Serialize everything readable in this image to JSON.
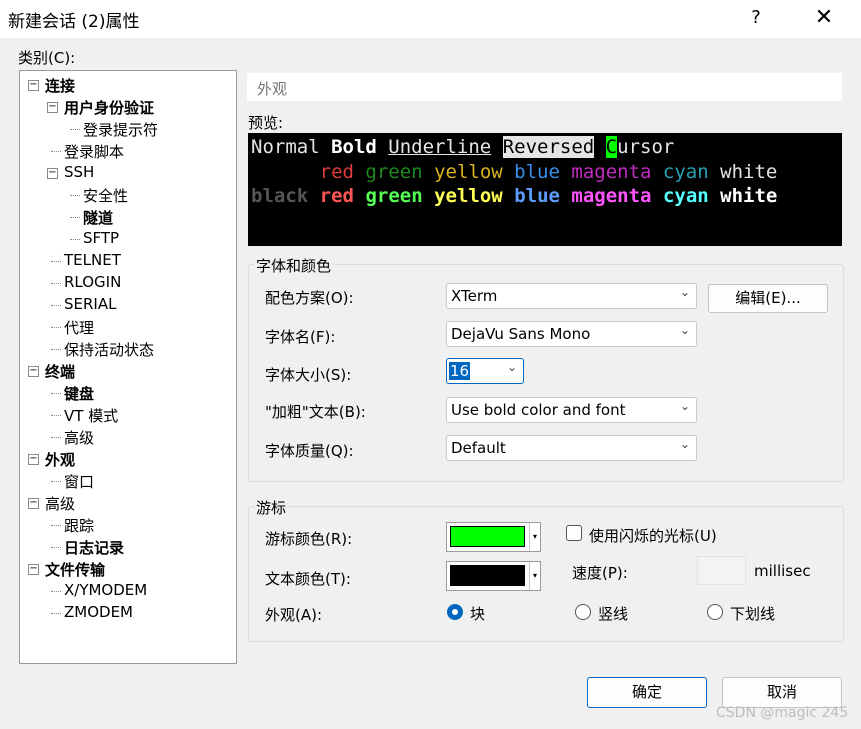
{
  "window": {
    "title": "新建会话 (2)属性",
    "help_label": "?",
    "close_label": "✕"
  },
  "category_label": "类别(C):",
  "tree": [
    {
      "label": "连接",
      "bold": true,
      "toggle": "−"
    },
    {
      "label": "用户身份验证",
      "bold": true,
      "toggle": "−"
    },
    {
      "label": "登录提示符",
      "bold": false
    },
    {
      "label": "登录脚本",
      "bold": false
    },
    {
      "label": "SSH",
      "bold": false,
      "toggle": "−"
    },
    {
      "label": "安全性",
      "bold": false
    },
    {
      "label": "隧道",
      "bold": true
    },
    {
      "label": "SFTP",
      "bold": false
    },
    {
      "label": "TELNET",
      "bold": false
    },
    {
      "label": "RLOGIN",
      "bold": false
    },
    {
      "label": "SERIAL",
      "bold": false
    },
    {
      "label": "代理",
      "bold": false
    },
    {
      "label": "保持活动状态",
      "bold": false
    },
    {
      "label": "终端",
      "bold": true,
      "toggle": "−"
    },
    {
      "label": "键盘",
      "bold": true
    },
    {
      "label": "VT 模式",
      "bold": false
    },
    {
      "label": "高级",
      "bold": false
    },
    {
      "label": "外观",
      "bold": true,
      "toggle": "−"
    },
    {
      "label": "窗口",
      "bold": false
    },
    {
      "label": "高级",
      "bold": false,
      "toggle": "−"
    },
    {
      "label": "跟踪",
      "bold": false
    },
    {
      "label": "日志记录",
      "bold": true
    },
    {
      "label": "文件传输",
      "bold": true,
      "toggle": "−"
    },
    {
      "label": "X/YMODEM",
      "bold": false
    },
    {
      "label": "ZMODEM",
      "bold": false
    }
  ],
  "section_header": "外观",
  "preview": {
    "label": "预览:",
    "line1": {
      "normal": "Normal ",
      "bold": "Bold",
      "underline": "Underline",
      "reversed": "Reversed",
      "cursor_char": "C",
      "cursor_rest": "ursor"
    },
    "colors": [
      {
        "text": "red",
        "color": "#e03a3a",
        "bright": "#ff5555"
      },
      {
        "text": "green",
        "color": "#1f8a1f",
        "bright": "#55ff55"
      },
      {
        "text": "yellow",
        "color": "#d7b21d",
        "bright": "#ffff55"
      },
      {
        "text": "blue",
        "color": "#3b8eea",
        "bright": "#5c9cff"
      },
      {
        "text": "magenta",
        "color": "#c02cc0",
        "bright": "#ff55ff"
      },
      {
        "text": "cyan",
        "color": "#2aa1b3",
        "bright": "#55ffff"
      },
      {
        "text": "white",
        "color": "#e5e5e5",
        "bright": "#ffffff"
      }
    ],
    "black_label": "black",
    "cursor_color": "#00ff00"
  },
  "font_group": {
    "title": "字体和颜色",
    "color_scheme_label": "配色方案(O):",
    "color_scheme_value": "XTerm",
    "edit_button": "编辑(E)...",
    "font_name_label": "字体名(F):",
    "font_name_value": "DejaVu Sans Mono",
    "font_size_label": "字体大小(S):",
    "font_size_value": "16",
    "bold_text_label": "\"加粗\"文本(B):",
    "bold_text_value": "Use bold color and font",
    "quality_label": "字体质量(Q):",
    "quality_value": "Default"
  },
  "cursor_group": {
    "title": "游标",
    "cursor_color_label": "游标颜色(R):",
    "cursor_color": "#00ff00",
    "text_color_label": "文本颜色(T):",
    "text_color": "#000000",
    "blink_label": "使用闪烁的光标(U)",
    "speed_label": "速度(P):",
    "speed_unit": "millisec",
    "appearance_label": "外观(A):",
    "options": [
      "块",
      "竖线",
      "下划线"
    ],
    "selected": "块"
  },
  "buttons": {
    "ok": "确定",
    "cancel": "取消"
  },
  "watermark": "CSDN @magic 245"
}
